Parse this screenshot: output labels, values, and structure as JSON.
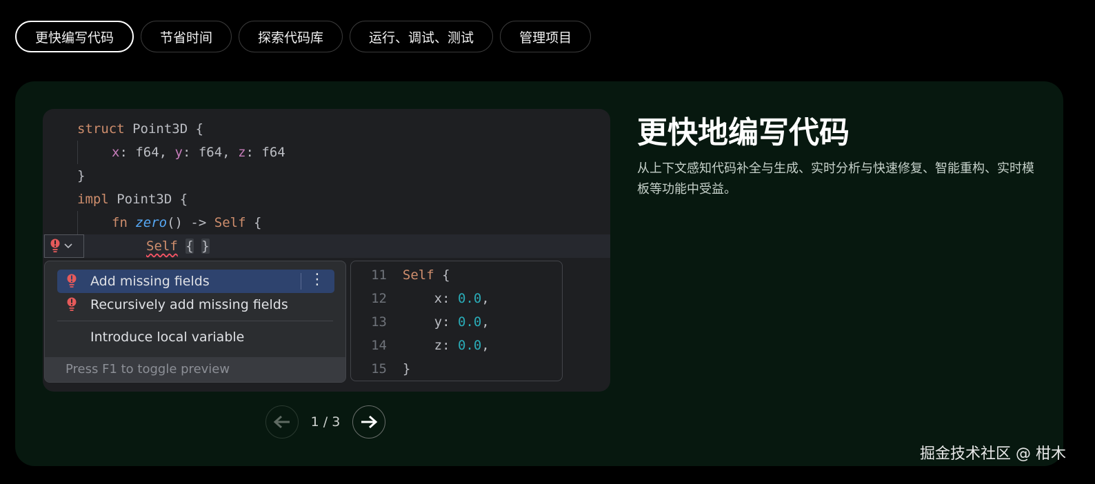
{
  "tabs": [
    {
      "label": "更快编写代码",
      "active": true
    },
    {
      "label": "节省时间",
      "active": false
    },
    {
      "label": "探索代码库",
      "active": false
    },
    {
      "label": "运行、调试、测试",
      "active": false
    },
    {
      "label": "管理项目",
      "active": false
    }
  ],
  "code": {
    "line1_kw": "struct",
    "line1_rest": " Point3D {",
    "line2_f1": "x",
    "line2_t1": ": f64, ",
    "line2_f2": "y",
    "line2_t2": ": f64, ",
    "line2_f3": "z",
    "line2_t3": ": f64",
    "line3": "}",
    "line4_kw": "impl",
    "line4_rest": " Point3D {",
    "line5_kw": "fn",
    "line5_fn": "zero",
    "line5_mid": "() -> ",
    "line5_self": "Self",
    "line5_end": " {",
    "line6_self": "Self",
    "line6_open": "{",
    "line6_close": "}"
  },
  "popup": {
    "items": [
      "Add missing fields",
      "Recursively add missing fields",
      "Introduce local variable"
    ],
    "footer": "Press F1 to toggle preview",
    "kebab": "⋮"
  },
  "preview": {
    "lines": [
      {
        "num": "11",
        "a": "Self",
        "b": " {",
        "val": ""
      },
      {
        "num": "12",
        "a": "    x: ",
        "b": ",",
        "val": "0.0"
      },
      {
        "num": "13",
        "a": "    y: ",
        "b": ",",
        "val": "0.0"
      },
      {
        "num": "14",
        "a": "    z: ",
        "b": ",",
        "val": "0.0"
      },
      {
        "num": "15",
        "a": "}",
        "b": "",
        "val": ""
      }
    ]
  },
  "pager": {
    "indicator": "1 / 3"
  },
  "feature": {
    "title": "更快地编写代码",
    "description": "从上下文感知代码补全与生成、实时分析与快速修复、智能重构、实时模板等功能中受益。"
  },
  "watermark": "掘金技术社区 @ 柑木",
  "colors": {
    "panel_bg": "#07180f",
    "editor_bg": "#1e1f22",
    "keyword": "#cf8e6d",
    "field": "#c77dbb",
    "function": "#56a8f5",
    "number": "#2aacb8",
    "selection": "#2e436e",
    "error": "#e55a5a"
  }
}
